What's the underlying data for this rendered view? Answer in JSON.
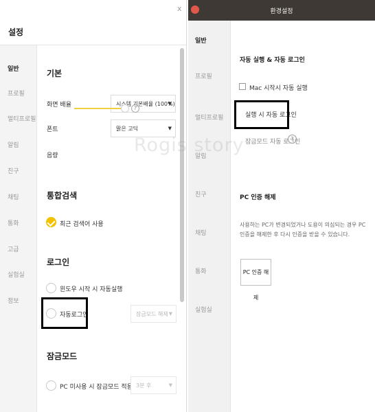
{
  "left_window": {
    "title": "설정",
    "close_label": "x",
    "sidebar": [
      {
        "label": "일반",
        "active": true
      },
      {
        "label": "프로필",
        "active": false
      },
      {
        "label": "멀티프로필",
        "active": false
      },
      {
        "label": "알림",
        "active": false
      },
      {
        "label": "친구",
        "active": false
      },
      {
        "label": "채팅",
        "active": false
      },
      {
        "label": "통화",
        "active": false
      },
      {
        "label": "고급",
        "active": false
      },
      {
        "label": "실험실",
        "active": false
      },
      {
        "label": "정보",
        "active": false
      }
    ],
    "basic": {
      "heading": "기본",
      "zoom_label": "화면 배율",
      "zoom_value": "시스템 기본배율 (100%)",
      "font_label": "폰트",
      "font_value": "맑은 고딕",
      "volume_label": "음량",
      "volume_help": "?"
    },
    "search": {
      "heading": "통합검색",
      "recent_label": "최근 검색어 사용",
      "recent_checked": true
    },
    "login": {
      "heading": "로그인",
      "autostart_label": "윈도우 시작 시 자동실행",
      "autologin_label": "자동로그인",
      "lockmode_value": "잠금모드 해제"
    },
    "lock": {
      "heading": "잠금모드",
      "idle_label": "PC 미사용 시 잠금모드 적용",
      "idle_value": "3분 후"
    }
  },
  "right_window": {
    "title": "환경설정",
    "sidebar": [
      {
        "label": "일반",
        "active": true
      },
      {
        "label": "프로필",
        "active": false
      },
      {
        "label": "멀티프로필",
        "active": false
      },
      {
        "label": "알림",
        "active": false
      },
      {
        "label": "친구",
        "active": false
      },
      {
        "label": "채팅",
        "active": false
      },
      {
        "label": "통화",
        "active": false
      },
      {
        "label": "실험실",
        "active": false
      }
    ],
    "autorun": {
      "heading": "자동 실행 & 자동 로그인",
      "mac_autostart_label": "Mac 시작시 자동 실행",
      "autologin_on_launch_label": "실행 시 자동 로그인",
      "lockmode_autologin_label": "잠금모드 자동 로그인",
      "help": "?"
    },
    "pc_auth": {
      "heading": "PC 인증 해제",
      "description": "사용하는 PC가 변경되었거나 도용이 의심되는 경우 PC 인증을 해제한 후 다시 인증을 받을 수 있습니다.",
      "button_label": "PC 인증 해제"
    }
  },
  "watermark": "Rogis story",
  "colors": {
    "accent_yellow": "#f2c200",
    "mac_titlebar": "#3e3935",
    "mac_close_dot": "#e2584b",
    "highlight_box": "#000000"
  }
}
